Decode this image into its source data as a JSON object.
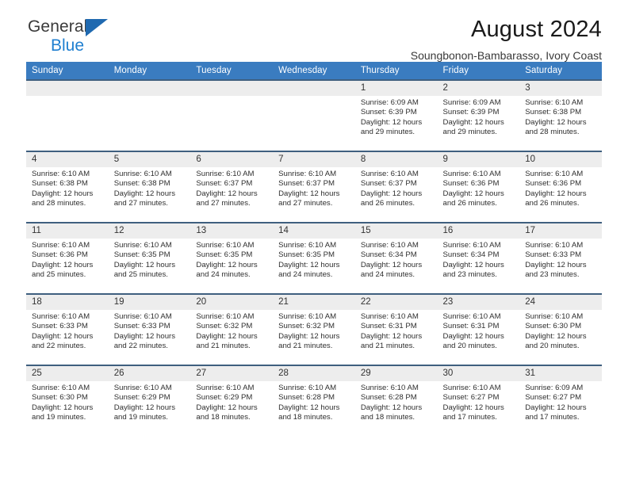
{
  "brand": {
    "name_line1": "General",
    "name_line2": "Blue",
    "logo_icon": "triangle-logo-icon",
    "colors": {
      "triangle": "#1f69b0",
      "blue_text": "#1f7fd0",
      "dark_text": "#3a3a3a"
    }
  },
  "header": {
    "title": "August 2024",
    "subtitle": "Soungbonon-Bambarasso, Ivory Coast"
  },
  "theme": {
    "header_row_bg": "#3a7cc0",
    "header_row_text": "#ffffff",
    "daynum_band_bg": "#ededed",
    "cell_border": "#3f5f7f"
  },
  "weekdays": [
    "Sunday",
    "Monday",
    "Tuesday",
    "Wednesday",
    "Thursday",
    "Friday",
    "Saturday"
  ],
  "labels": {
    "sunrise_prefix": "Sunrise: ",
    "sunset_prefix": "Sunset: ",
    "daylight_prefix": "Daylight: "
  },
  "weeks": [
    [
      {
        "day": "",
        "sunrise": "",
        "sunset": "",
        "daylight": "",
        "empty": true
      },
      {
        "day": "",
        "sunrise": "",
        "sunset": "",
        "daylight": "",
        "empty": true
      },
      {
        "day": "",
        "sunrise": "",
        "sunset": "",
        "daylight": "",
        "empty": true
      },
      {
        "day": "",
        "sunrise": "",
        "sunset": "",
        "daylight": "",
        "empty": true
      },
      {
        "day": "1",
        "sunrise": "Sunrise: 6:09 AM",
        "sunset": "Sunset: 6:39 PM",
        "daylight": "Daylight: 12 hours and 29 minutes.",
        "empty": false
      },
      {
        "day": "2",
        "sunrise": "Sunrise: 6:09 AM",
        "sunset": "Sunset: 6:39 PM",
        "daylight": "Daylight: 12 hours and 29 minutes.",
        "empty": false
      },
      {
        "day": "3",
        "sunrise": "Sunrise: 6:10 AM",
        "sunset": "Sunset: 6:38 PM",
        "daylight": "Daylight: 12 hours and 28 minutes.",
        "empty": false
      }
    ],
    [
      {
        "day": "4",
        "sunrise": "Sunrise: 6:10 AM",
        "sunset": "Sunset: 6:38 PM",
        "daylight": "Daylight: 12 hours and 28 minutes.",
        "empty": false
      },
      {
        "day": "5",
        "sunrise": "Sunrise: 6:10 AM",
        "sunset": "Sunset: 6:38 PM",
        "daylight": "Daylight: 12 hours and 27 minutes.",
        "empty": false
      },
      {
        "day": "6",
        "sunrise": "Sunrise: 6:10 AM",
        "sunset": "Sunset: 6:37 PM",
        "daylight": "Daylight: 12 hours and 27 minutes.",
        "empty": false
      },
      {
        "day": "7",
        "sunrise": "Sunrise: 6:10 AM",
        "sunset": "Sunset: 6:37 PM",
        "daylight": "Daylight: 12 hours and 27 minutes.",
        "empty": false
      },
      {
        "day": "8",
        "sunrise": "Sunrise: 6:10 AM",
        "sunset": "Sunset: 6:37 PM",
        "daylight": "Daylight: 12 hours and 26 minutes.",
        "empty": false
      },
      {
        "day": "9",
        "sunrise": "Sunrise: 6:10 AM",
        "sunset": "Sunset: 6:36 PM",
        "daylight": "Daylight: 12 hours and 26 minutes.",
        "empty": false
      },
      {
        "day": "10",
        "sunrise": "Sunrise: 6:10 AM",
        "sunset": "Sunset: 6:36 PM",
        "daylight": "Daylight: 12 hours and 26 minutes.",
        "empty": false
      }
    ],
    [
      {
        "day": "11",
        "sunrise": "Sunrise: 6:10 AM",
        "sunset": "Sunset: 6:36 PM",
        "daylight": "Daylight: 12 hours and 25 minutes.",
        "empty": false
      },
      {
        "day": "12",
        "sunrise": "Sunrise: 6:10 AM",
        "sunset": "Sunset: 6:35 PM",
        "daylight": "Daylight: 12 hours and 25 minutes.",
        "empty": false
      },
      {
        "day": "13",
        "sunrise": "Sunrise: 6:10 AM",
        "sunset": "Sunset: 6:35 PM",
        "daylight": "Daylight: 12 hours and 24 minutes.",
        "empty": false
      },
      {
        "day": "14",
        "sunrise": "Sunrise: 6:10 AM",
        "sunset": "Sunset: 6:35 PM",
        "daylight": "Daylight: 12 hours and 24 minutes.",
        "empty": false
      },
      {
        "day": "15",
        "sunrise": "Sunrise: 6:10 AM",
        "sunset": "Sunset: 6:34 PM",
        "daylight": "Daylight: 12 hours and 24 minutes.",
        "empty": false
      },
      {
        "day": "16",
        "sunrise": "Sunrise: 6:10 AM",
        "sunset": "Sunset: 6:34 PM",
        "daylight": "Daylight: 12 hours and 23 minutes.",
        "empty": false
      },
      {
        "day": "17",
        "sunrise": "Sunrise: 6:10 AM",
        "sunset": "Sunset: 6:33 PM",
        "daylight": "Daylight: 12 hours and 23 minutes.",
        "empty": false
      }
    ],
    [
      {
        "day": "18",
        "sunrise": "Sunrise: 6:10 AM",
        "sunset": "Sunset: 6:33 PM",
        "daylight": "Daylight: 12 hours and 22 minutes.",
        "empty": false
      },
      {
        "day": "19",
        "sunrise": "Sunrise: 6:10 AM",
        "sunset": "Sunset: 6:33 PM",
        "daylight": "Daylight: 12 hours and 22 minutes.",
        "empty": false
      },
      {
        "day": "20",
        "sunrise": "Sunrise: 6:10 AM",
        "sunset": "Sunset: 6:32 PM",
        "daylight": "Daylight: 12 hours and 21 minutes.",
        "empty": false
      },
      {
        "day": "21",
        "sunrise": "Sunrise: 6:10 AM",
        "sunset": "Sunset: 6:32 PM",
        "daylight": "Daylight: 12 hours and 21 minutes.",
        "empty": false
      },
      {
        "day": "22",
        "sunrise": "Sunrise: 6:10 AM",
        "sunset": "Sunset: 6:31 PM",
        "daylight": "Daylight: 12 hours and 21 minutes.",
        "empty": false
      },
      {
        "day": "23",
        "sunrise": "Sunrise: 6:10 AM",
        "sunset": "Sunset: 6:31 PM",
        "daylight": "Daylight: 12 hours and 20 minutes.",
        "empty": false
      },
      {
        "day": "24",
        "sunrise": "Sunrise: 6:10 AM",
        "sunset": "Sunset: 6:30 PM",
        "daylight": "Daylight: 12 hours and 20 minutes.",
        "empty": false
      }
    ],
    [
      {
        "day": "25",
        "sunrise": "Sunrise: 6:10 AM",
        "sunset": "Sunset: 6:30 PM",
        "daylight": "Daylight: 12 hours and 19 minutes.",
        "empty": false
      },
      {
        "day": "26",
        "sunrise": "Sunrise: 6:10 AM",
        "sunset": "Sunset: 6:29 PM",
        "daylight": "Daylight: 12 hours and 19 minutes.",
        "empty": false
      },
      {
        "day": "27",
        "sunrise": "Sunrise: 6:10 AM",
        "sunset": "Sunset: 6:29 PM",
        "daylight": "Daylight: 12 hours and 18 minutes.",
        "empty": false
      },
      {
        "day": "28",
        "sunrise": "Sunrise: 6:10 AM",
        "sunset": "Sunset: 6:28 PM",
        "daylight": "Daylight: 12 hours and 18 minutes.",
        "empty": false
      },
      {
        "day": "29",
        "sunrise": "Sunrise: 6:10 AM",
        "sunset": "Sunset: 6:28 PM",
        "daylight": "Daylight: 12 hours and 18 minutes.",
        "empty": false
      },
      {
        "day": "30",
        "sunrise": "Sunrise: 6:10 AM",
        "sunset": "Sunset: 6:27 PM",
        "daylight": "Daylight: 12 hours and 17 minutes.",
        "empty": false
      },
      {
        "day": "31",
        "sunrise": "Sunrise: 6:09 AM",
        "sunset": "Sunset: 6:27 PM",
        "daylight": "Daylight: 12 hours and 17 minutes.",
        "empty": false
      }
    ]
  ]
}
